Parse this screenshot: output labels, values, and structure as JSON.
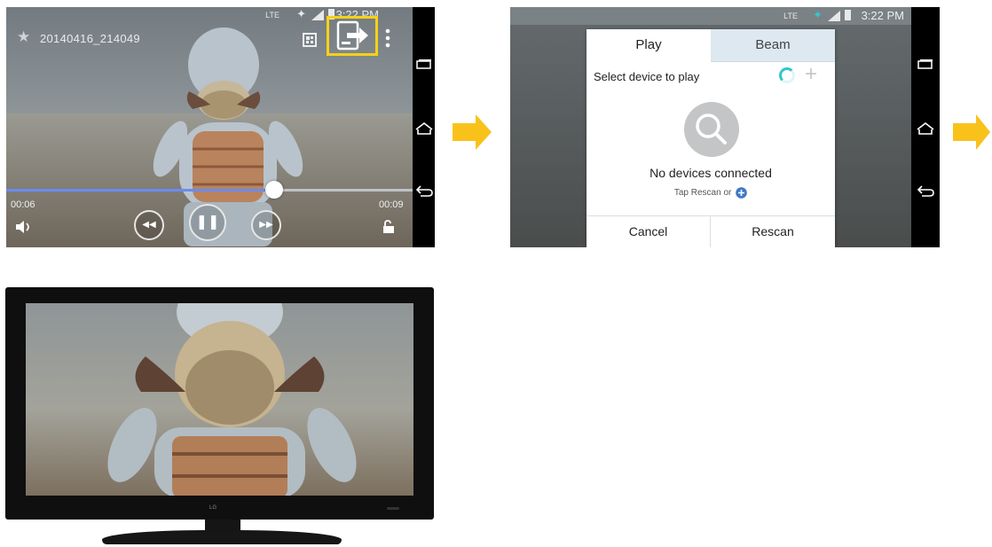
{
  "phone1": {
    "status_bar": {
      "network": "LTE",
      "time": "3:22 PM"
    },
    "video_title": "20140416_214049",
    "playback": {
      "elapsed": "00:06",
      "duration": "00:09",
      "progress_fraction": 0.66
    },
    "accent_color": "#6a8bf0",
    "highlight_color": "#f7d117"
  },
  "phone2": {
    "status_bar": {
      "network": "LTE",
      "time": "3:22 PM"
    },
    "dialog": {
      "tabs": [
        {
          "label": "Play",
          "active": true
        },
        {
          "label": "Beam",
          "active": false
        }
      ],
      "heading": "Select device to play",
      "empty_state_title": "No devices connected",
      "empty_state_hint": "Tap Rescan or",
      "cancel_label": "Cancel",
      "rescan_label": "Rescan"
    }
  },
  "arrow_color": "#f9c21b",
  "tv": {
    "brand_logo": "LG"
  }
}
